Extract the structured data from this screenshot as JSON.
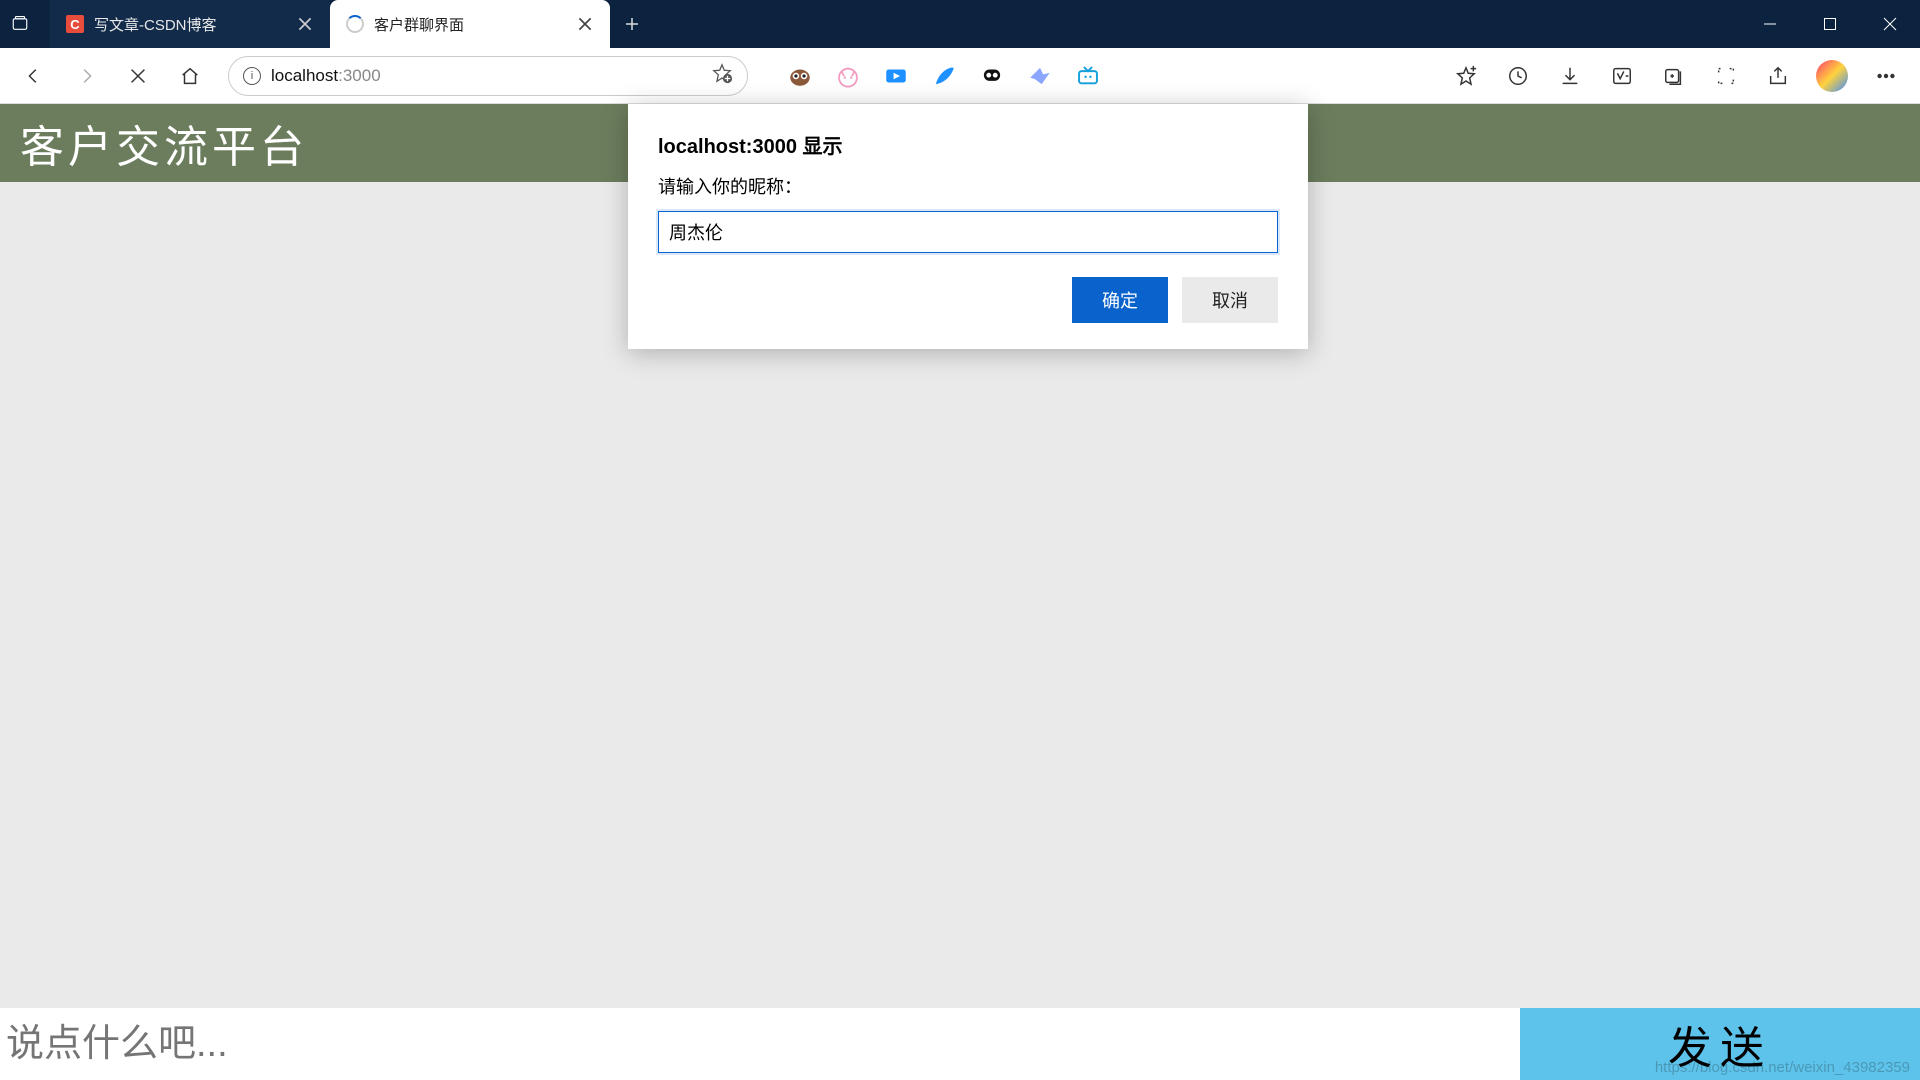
{
  "tabs": {
    "items": [
      {
        "title": "写文章-CSDN博客",
        "favicon": "csdn"
      },
      {
        "title": "客户群聊界面",
        "favicon": "loading"
      }
    ],
    "activeIndex": 1
  },
  "addressbar": {
    "prefix": "localhost",
    "suffix": ":3000"
  },
  "page": {
    "headerTitle": "客户交流平台",
    "messagePlaceholder": "说点什么吧...",
    "sendLabel": "发送"
  },
  "dialog": {
    "title": "localhost:3000 显示",
    "label": "请输入你的昵称：",
    "inputValue": "周杰伦",
    "okLabel": "确定",
    "cancelLabel": "取消"
  },
  "watermark": "https://blog.csdn.net/weixin_43982359"
}
